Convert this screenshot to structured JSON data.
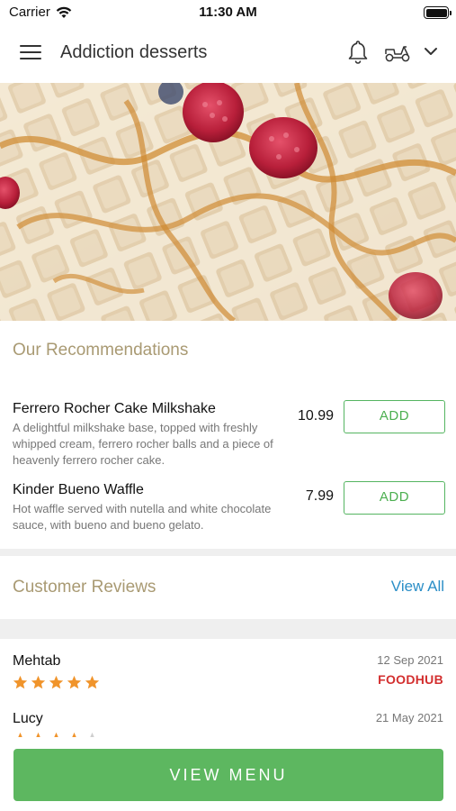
{
  "status_bar": {
    "carrier": "Carrier",
    "time": "11:30 AM"
  },
  "header": {
    "title": "Addiction desserts",
    "icons": [
      "menu-icon",
      "bell-icon",
      "scooter-icon",
      "chevron-down-icon"
    ]
  },
  "hero": {
    "image": "waffles with raspberries and caramel drizzle"
  },
  "recommendations": {
    "heading": "Our Recommendations",
    "add_label": "ADD",
    "items": [
      {
        "name": "Ferrero Rocher Cake Milkshake",
        "description": "A delightful milkshake base, topped with freshly whipped cream, ferrero rocher balls and a piece of heavenly ferrero rocher cake.",
        "price": "10.99"
      },
      {
        "name": "Kinder Bueno Waffle",
        "description": "Hot waffle served with nutella and white chocolate sauce, with bueno and bueno gelato.",
        "price": "7.99"
      }
    ]
  },
  "reviews": {
    "heading": "Customer Reviews",
    "view_all": "View All",
    "items": [
      {
        "name": "Mehtab",
        "date": "12 Sep 2021",
        "rating": 5,
        "source": "FOODHUB"
      },
      {
        "name": "Lucy",
        "date": "21 May 2021",
        "rating": 4
      }
    ]
  },
  "cta": {
    "view_menu": "VIEW MENU"
  },
  "colors": {
    "accent_green": "#5db760",
    "heading_gold": "#a99a73",
    "link_blue": "#2a8ec7",
    "star_orange": "#f0942b",
    "foodhub_red": "#d32f2f"
  }
}
